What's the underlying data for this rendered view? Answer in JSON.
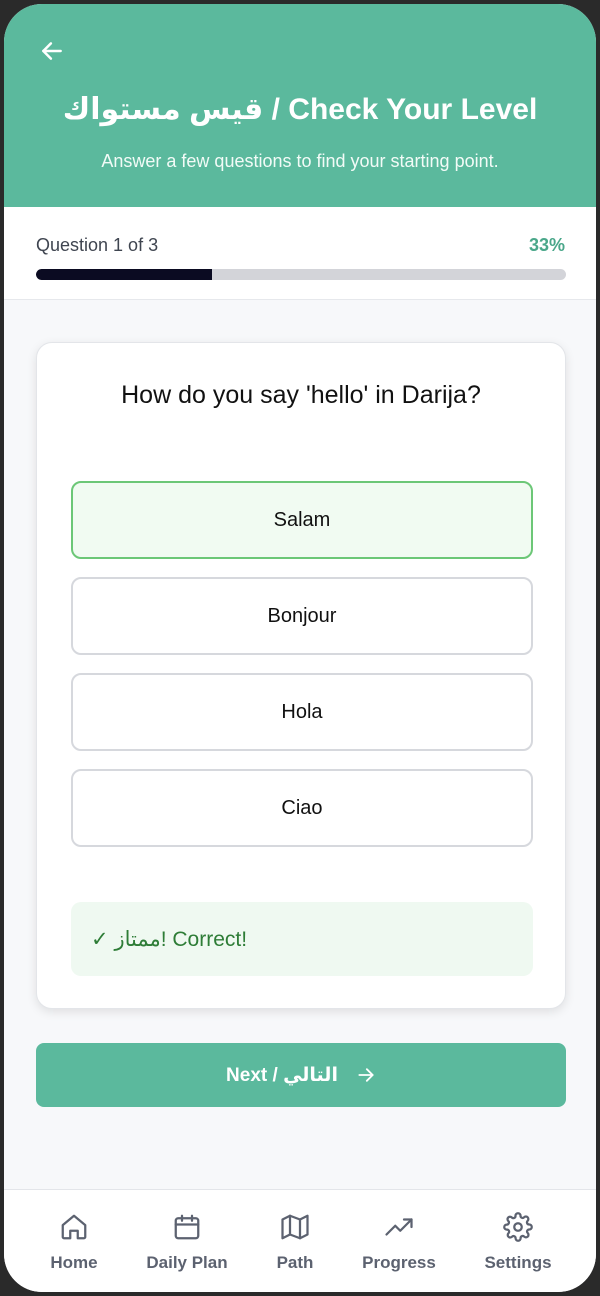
{
  "header": {
    "title": "قيس مستواك / Check Your Level",
    "subtitle": "Answer a few questions to find your starting point."
  },
  "progress": {
    "label": "Question 1 of 3",
    "percent_text": "33%",
    "fraction": 0.333
  },
  "quiz": {
    "question": "How do you say 'hello' in Darija?",
    "options": [
      {
        "label": "Salam",
        "selected": true
      },
      {
        "label": "Bonjour",
        "selected": false
      },
      {
        "label": "Hola",
        "selected": false
      },
      {
        "label": "Ciao",
        "selected": false
      }
    ],
    "feedback": "✓ ممتاز! Correct!"
  },
  "next_button": {
    "label": "Next / التالي"
  },
  "nav": {
    "items": [
      {
        "label": "Home",
        "icon": "home-icon"
      },
      {
        "label": "Daily Plan",
        "icon": "calendar-icon"
      },
      {
        "label": "Path",
        "icon": "map-icon"
      },
      {
        "label": "Progress",
        "icon": "trending-up-icon"
      },
      {
        "label": "Settings",
        "icon": "gear-icon"
      }
    ]
  },
  "colors": {
    "primary": "#5bb99d",
    "progress_fill": "#0b0b22",
    "correct_border": "#6cc777",
    "correct_text": "#2e7d37"
  }
}
